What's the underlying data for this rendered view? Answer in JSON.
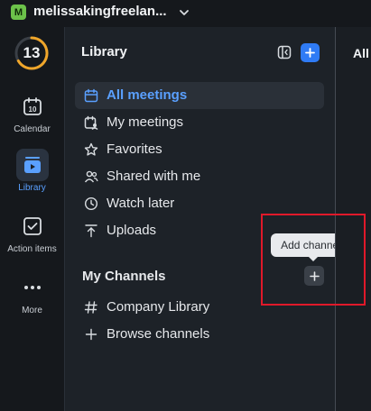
{
  "workspace": {
    "badge": "M",
    "name": "melissakingfreelan...",
    "chevron_icon": "chevron-down-icon",
    "badge_color": "#6cc24a"
  },
  "rail": {
    "score": "13",
    "items": [
      {
        "label": "Calendar",
        "icon": "calendar-icon",
        "date": "10"
      },
      {
        "label": "Library",
        "icon": "library-icon",
        "active": true
      },
      {
        "label": "Action items",
        "icon": "checkbox-icon"
      },
      {
        "label": "More",
        "icon": "more-dots-icon"
      }
    ]
  },
  "library": {
    "title": "Library",
    "nav": [
      {
        "label": "All meetings",
        "icon": "calendar-icon",
        "active": true
      },
      {
        "label": "My meetings",
        "icon": "calendar-user-icon"
      },
      {
        "label": "Favorites",
        "icon": "star-icon"
      },
      {
        "label": "Shared with me",
        "icon": "users-icon"
      },
      {
        "label": "Watch later",
        "icon": "clock-icon"
      },
      {
        "label": "Uploads",
        "icon": "upload-icon"
      }
    ],
    "channels_title": "My Channels",
    "channels": [
      {
        "label": "Company Library",
        "icon": "hash-icon"
      },
      {
        "label": "Browse channels",
        "icon": "plus-icon"
      }
    ],
    "tooltip": "Add channels"
  },
  "content": {
    "title": "All"
  },
  "colors": {
    "accent": "#2f7bf5",
    "active_text": "#5aa0ff",
    "highlight": "#e0192a"
  }
}
